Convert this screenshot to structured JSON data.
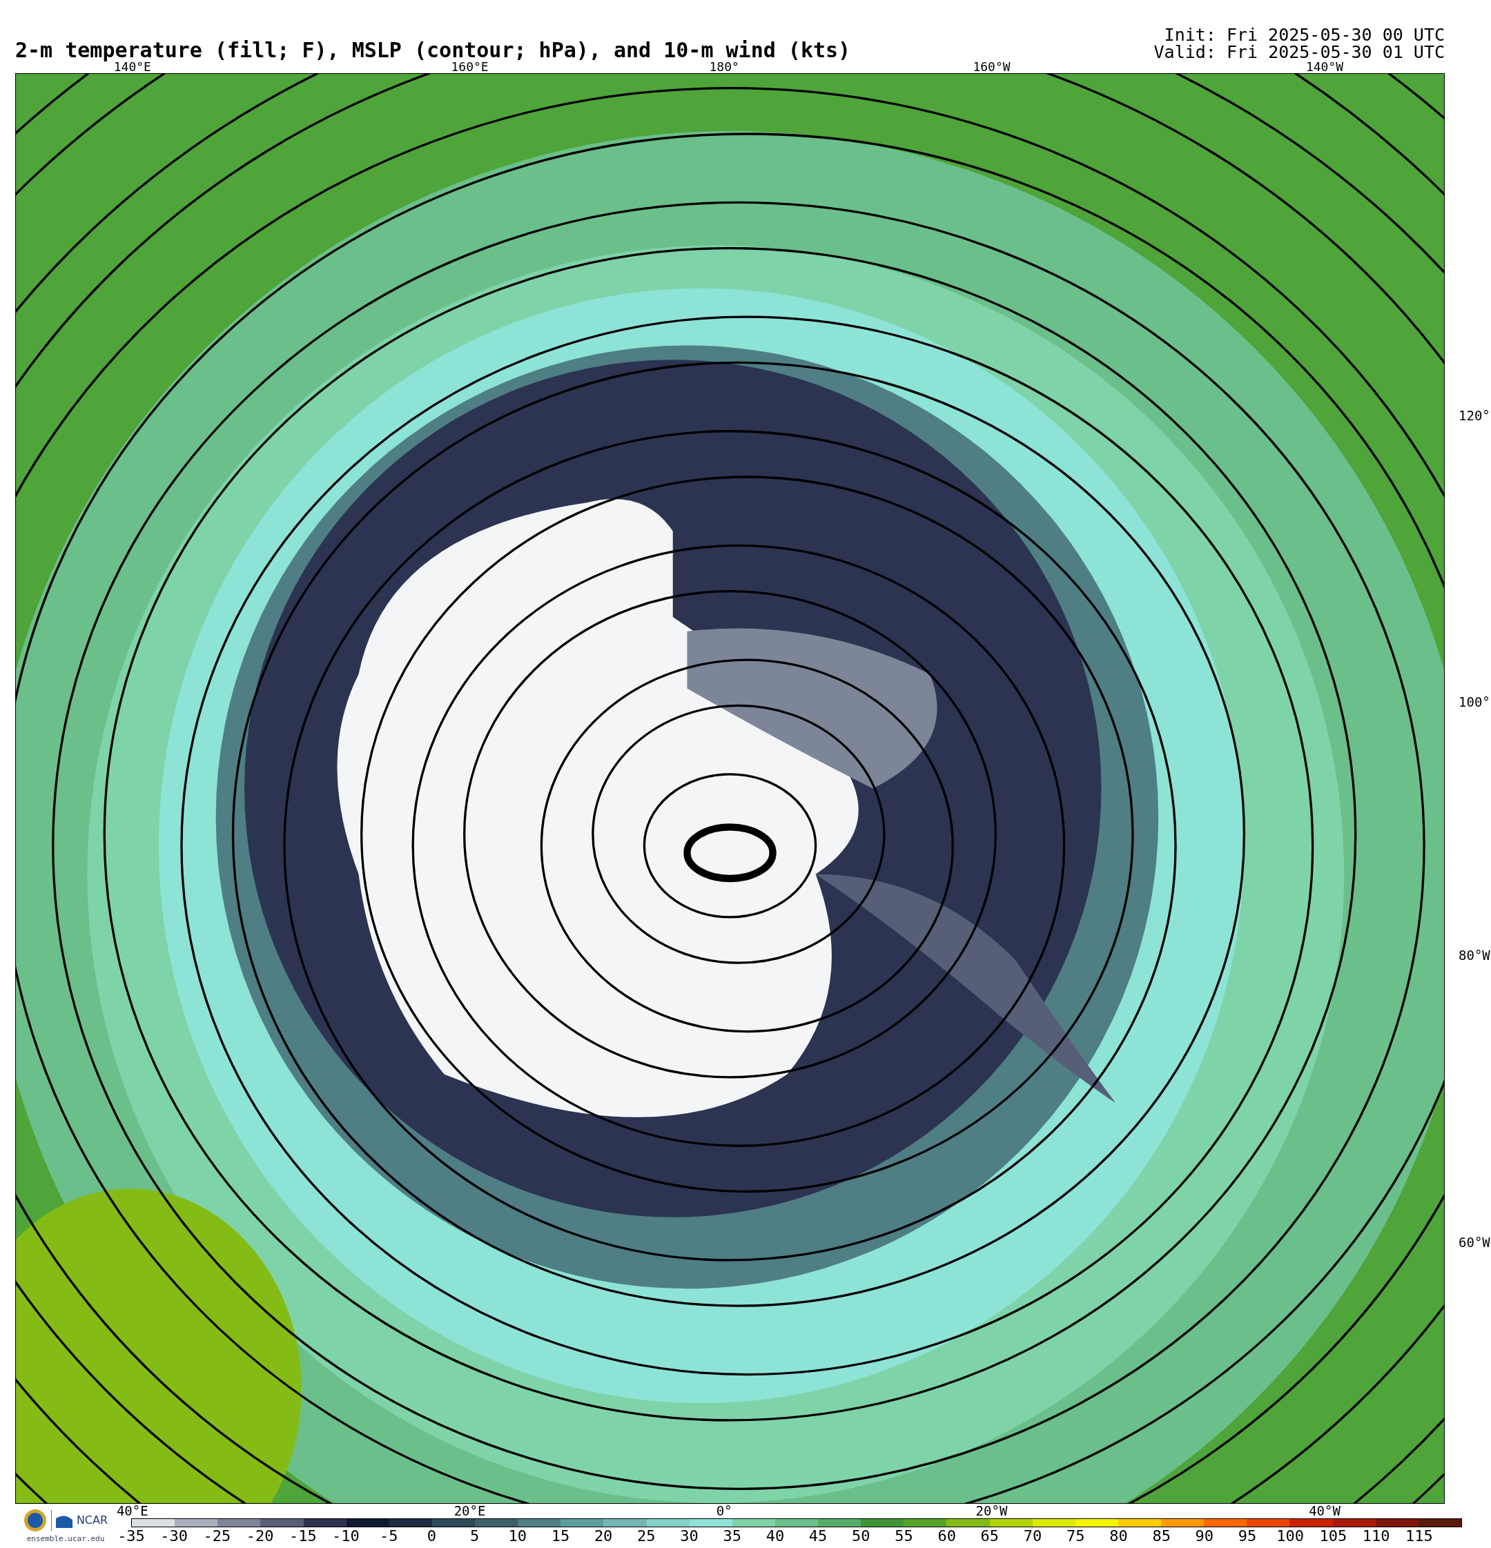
{
  "header": {
    "title": "2-m temperature (fill; F), MSLP (contour; hPa), and 10-m wind (kts)",
    "init": "Init: Fri 2025-05-30 00 UTC",
    "valid": "Valid: Fri 2025-05-30 01 UTC"
  },
  "map": {
    "top_labels": [
      "140°E",
      "160°E",
      "180°",
      "160°W",
      "140°W"
    ],
    "right_labels": [
      "120°",
      "100°",
      "80°W",
      "60°W"
    ],
    "bottom_labels": [
      "40°E",
      "20°E",
      "0°",
      "20°W",
      "40°W"
    ]
  },
  "footer": {
    "logo_text": "NCAR",
    "site": "ensemble.ucar.edu"
  },
  "colorbar": {
    "ticks": [
      "-35",
      "-30",
      "-25",
      "-20",
      "-15",
      "-10",
      "-5",
      "0",
      "5",
      "10",
      "15",
      "20",
      "25",
      "30",
      "35",
      "40",
      "45",
      "50",
      "55",
      "60",
      "65",
      "70",
      "75",
      "80",
      "85",
      "90",
      "95",
      "100",
      "105",
      "110",
      "115"
    ],
    "bins": [
      {
        "color": "#dcdfe3"
      },
      {
        "color": "#aab0bc"
      },
      {
        "color": "#7d8699"
      },
      {
        "color": "#565f77"
      },
      {
        "color": "#2c3452"
      },
      {
        "color": "#0f1a33"
      },
      {
        "color": "#1e2d45"
      },
      {
        "color": "#2e4a5a"
      },
      {
        "color": "#3e6068"
      },
      {
        "color": "#4f7e85"
      },
      {
        "color": "#5f9ea0"
      },
      {
        "color": "#73b6b3"
      },
      {
        "color": "#84d1c8"
      },
      {
        "color": "#8de3d6"
      },
      {
        "color": "#7fd3a8"
      },
      {
        "color": "#6bbf8a"
      },
      {
        "color": "#56ad67"
      },
      {
        "color": "#3f9438"
      },
      {
        "color": "#56a52a"
      },
      {
        "color": "#84bb14"
      },
      {
        "color": "#b0d400"
      },
      {
        "color": "#dcea00"
      },
      {
        "color": "#f5f500"
      },
      {
        "color": "#ffcc00"
      },
      {
        "color": "#ff9900"
      },
      {
        "color": "#ff6600"
      },
      {
        "color": "#ee4400"
      },
      {
        "color": "#cc2200"
      },
      {
        "color": "#aa1a0a"
      },
      {
        "color": "#7e150a"
      },
      {
        "color": "#5a1a0a"
      }
    ]
  }
}
